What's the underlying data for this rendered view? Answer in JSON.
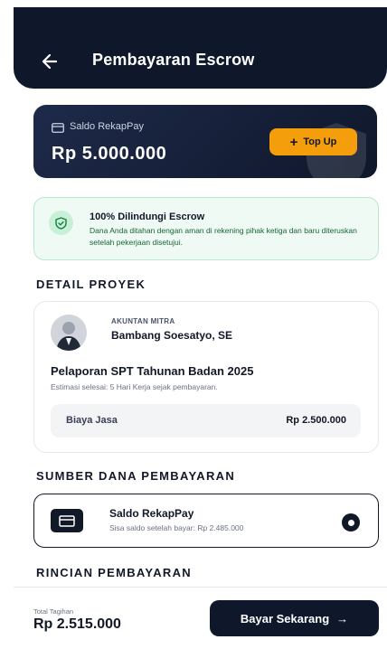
{
  "header": {
    "title": "Pembayaran Escrow"
  },
  "balance": {
    "label": "Saldo RekapPay",
    "amount": "Rp 5.000.000",
    "topup_label": "Top Up",
    "topup_plus": "+"
  },
  "escrow": {
    "title": "100% Dilindungi Escrow",
    "description": "Dana Anda ditahan dengan aman di rekening pihak ketiga dan baru diteruskan setelah pekerjaan disetujui."
  },
  "project_section": {
    "heading": "DETAIL PROYEK",
    "accountant_role": "AKUNTAN MITRA",
    "accountant_name": "Bambang Soesatyo, SE",
    "project_title": "Pelaporan SPT Tahunan Badan 2025",
    "estimate": "Estimasi selesai: 5 Hari Kerja sejak pembayaran.",
    "fee_label": "Biaya Jasa",
    "fee_value": "Rp 2.500.000"
  },
  "source_section": {
    "heading": "SUMBER DANA PEMBAYARAN",
    "method_title": "Saldo RekapPay",
    "method_desc": "Sisa saldo setelah bayar: Rp 2.485.000",
    "selected": true
  },
  "breakdown_section": {
    "heading": "RINCIAN PEMBAYARAN"
  },
  "footer": {
    "total_label": "Total Tagihan",
    "total_value": "Rp 2.515.000",
    "pay_label": "Bayar Sekarang",
    "pay_arrow": "→"
  },
  "colors": {
    "navy": "#0f172a",
    "accent": "#f59e0b",
    "success_bg": "#effaf4",
    "success_border": "#b7e9cc"
  }
}
